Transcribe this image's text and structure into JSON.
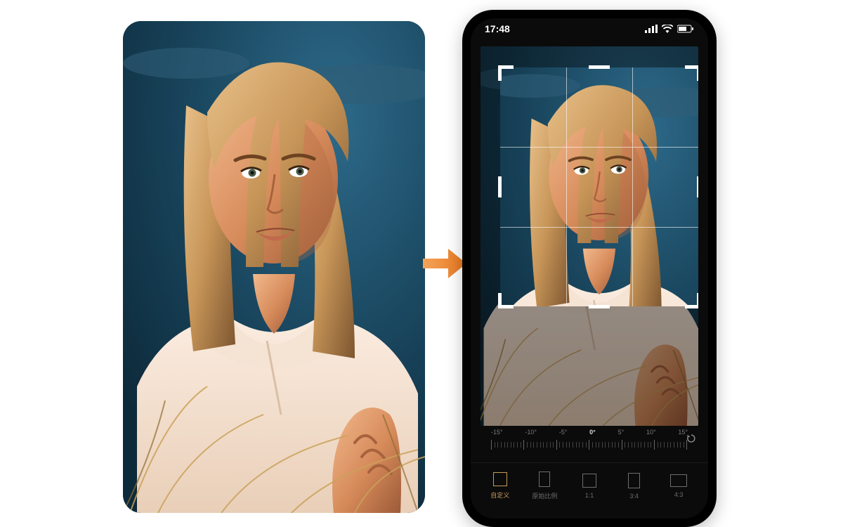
{
  "status": {
    "time": "17:48"
  },
  "straighten": {
    "ticks": [
      "-15°",
      "-10°",
      "-5°",
      "0°",
      "5°",
      "10°",
      "15°"
    ],
    "current": "0°"
  },
  "ratios": [
    {
      "key": "free",
      "label": "自定义",
      "shape": "r-free",
      "selected": true
    },
    {
      "key": "original",
      "label": "原始比例",
      "shape": "r-orig",
      "selected": false
    },
    {
      "key": "1:1",
      "label": "1:1",
      "shape": "r-11",
      "selected": false
    },
    {
      "key": "3:4",
      "label": "3:4",
      "shape": "r-34",
      "selected": false
    },
    {
      "key": "4:3",
      "label": "4:3",
      "shape": "r-43",
      "selected": false
    }
  ],
  "colors": {
    "accent": "#c79b5a",
    "arrow": "#f08a3c"
  }
}
